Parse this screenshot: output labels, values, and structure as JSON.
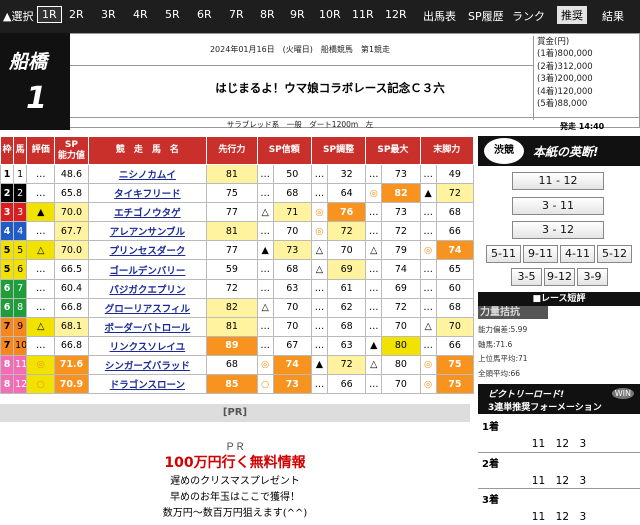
{
  "nav": {
    "select": "▲選択",
    "races": [
      "1R",
      "2R",
      "3R",
      "4R",
      "5R",
      "6R",
      "7R",
      "8R",
      "9R",
      "10R",
      "11R",
      "12R"
    ],
    "active": "1R",
    "links": [
      "出馬表",
      "SP履歴",
      "ランク",
      "推奨",
      "結果"
    ]
  },
  "venue": {
    "name": "船橋",
    "race": "1"
  },
  "race": {
    "date": "2024年01月16日　(火曜日)　船橋競馬　第1競走",
    "title": "はじまるよ！ウマ娘コラボレース記念Ｃ３六",
    "info": "サラブレッド系　一般　ダート1200m　左",
    "start": "発走 14:40"
  },
  "prize": {
    "head": "賞金(円)",
    "lines": [
      "(1着)800,000",
      "(2着)312,000",
      "(3着)200,000",
      "(4着)120,000",
      "(5着)88,000"
    ]
  },
  "table": {
    "headers": {
      "waku": "枠",
      "uma": "馬",
      "hyoka": "評価",
      "sp": "SP\n能力値",
      "name": "競　走　馬　名",
      "senko": "先行力",
      "shinrai": "SP信頼",
      "chosei": "SP調整",
      "max": "SP最大",
      "matsu": "末脚力"
    },
    "rows": [
      {
        "waku": "1",
        "uma": "1",
        "m": "…",
        "sp": "48.6",
        "name": "ニシノカムイ",
        "senko": "81",
        "m1": "…",
        "shinrai": "50",
        "m2": "…",
        "chosei": "32",
        "m3": "…",
        "max": "73",
        "m4": "…",
        "matsu": "49"
      },
      {
        "waku": "2",
        "uma": "2",
        "m": "…",
        "sp": "65.8",
        "name": "タイキフリード",
        "senko": "75",
        "m1": "…",
        "shinrai": "68",
        "m2": "…",
        "chosei": "64",
        "m3": "◎",
        "max": "82",
        "m4": "▲",
        "matsu": "72"
      },
      {
        "waku": "3",
        "uma": "3",
        "m": "▲",
        "sp": "70.0",
        "name": "エチゴノウタゲ",
        "senko": "77",
        "m1": "△",
        "shinrai": "71",
        "m2": "◎",
        "chosei": "76",
        "m3": "…",
        "max": "73",
        "m4": "…",
        "matsu": "68"
      },
      {
        "waku": "4",
        "uma": "4",
        "m": "…",
        "sp": "67.7",
        "name": "アレアンサンブル",
        "senko": "81",
        "m1": "…",
        "shinrai": "70",
        "m2": "◎",
        "chosei": "72",
        "m3": "…",
        "max": "72",
        "m4": "…",
        "matsu": "66"
      },
      {
        "waku": "5",
        "uma": "5",
        "m": "△",
        "sp": "70.0",
        "name": "プリンセスダーク",
        "senko": "77",
        "m1": "▲",
        "shinrai": "73",
        "m2": "△",
        "chosei": "70",
        "m3": "△",
        "max": "79",
        "m4": "◎",
        "matsu": "74"
      },
      {
        "waku": "5",
        "uma": "6",
        "m": "…",
        "sp": "66.5",
        "name": "ゴールデンバリー",
        "senko": "59",
        "m1": "…",
        "shinrai": "68",
        "m2": "△",
        "chosei": "69",
        "m3": "…",
        "max": "74",
        "m4": "…",
        "matsu": "65"
      },
      {
        "waku": "6",
        "uma": "7",
        "m": "…",
        "sp": "60.4",
        "name": "パジガクエプリン",
        "senko": "72",
        "m1": "…",
        "shinrai": "63",
        "m2": "…",
        "chosei": "61",
        "m3": "…",
        "max": "69",
        "m4": "…",
        "matsu": "60"
      },
      {
        "waku": "6",
        "uma": "8",
        "m": "…",
        "sp": "66.8",
        "name": "グローリアスフィル",
        "senko": "82",
        "m1": "△",
        "shinrai": "70",
        "m2": "…",
        "chosei": "62",
        "m3": "…",
        "max": "72",
        "m4": "…",
        "matsu": "68"
      },
      {
        "waku": "7",
        "uma": "9",
        "m": "△",
        "sp": "68.1",
        "name": "ボーダーバトロール",
        "senko": "81",
        "m1": "…",
        "shinrai": "70",
        "m2": "…",
        "chosei": "68",
        "m3": "…",
        "max": "70",
        "m4": "△",
        "matsu": "70"
      },
      {
        "waku": "7",
        "uma": "10",
        "m": "…",
        "sp": "66.8",
        "name": "リンクスソレイユ",
        "senko": "89",
        "m1": "…",
        "shinrai": "67",
        "m2": "…",
        "chosei": "63",
        "m3": "▲",
        "max": "80",
        "m4": "…",
        "matsu": "66"
      },
      {
        "waku": "8",
        "uma": "11",
        "m": "◎",
        "sp": "71.6",
        "name": "シンガーズバラッド",
        "senko": "68",
        "m1": "◎",
        "shinrai": "74",
        "m2": "▲",
        "chosei": "72",
        "m3": "△",
        "max": "80",
        "m4": "◎",
        "matsu": "75"
      },
      {
        "waku": "8",
        "uma": "12",
        "m": "○",
        "sp": "70.9",
        "name": "ドラゴンスローン",
        "senko": "85",
        "m1": "○",
        "shinrai": "73",
        "m2": "…",
        "chosei": "66",
        "m3": "…",
        "max": "70",
        "m4": "◎",
        "matsu": "75"
      }
    ]
  },
  "right": {
    "badge": "渋競",
    "honmei": "本紙の英断!",
    "picks": [
      "11 - 12",
      "3 - 11",
      "3 - 12",
      "5-11",
      "9-11",
      "4-11",
      "5-12",
      "3-5",
      "9-12",
      "3-9"
    ],
    "summary_title": "■レース短評",
    "tag": "力量拮抗",
    "ratios": [
      "能力偏差:5.99",
      "軸馬:71.6",
      "上位馬平均:71",
      "全頭平均:66"
    ],
    "victory_a": "ビクトリーロード!",
    "victory_b": "3連単推奨フォーメーション",
    "win": "WIN",
    "formation": [
      {
        "label": "1着",
        "values": "11　12　3"
      },
      {
        "label": "2着",
        "values": "11　12　3"
      },
      {
        "label": "3着",
        "values": "11　12　3"
      }
    ]
  },
  "pr": {
    "bar": "[PR]",
    "label": "ＰＲ",
    "big": "100万円行く無料情報",
    "l1": "遅めのクリスマスプレゼント",
    "l2": "早めのお年玉はここで獲得！",
    "l3": "数万円～数百万円狙えます(^^)"
  }
}
